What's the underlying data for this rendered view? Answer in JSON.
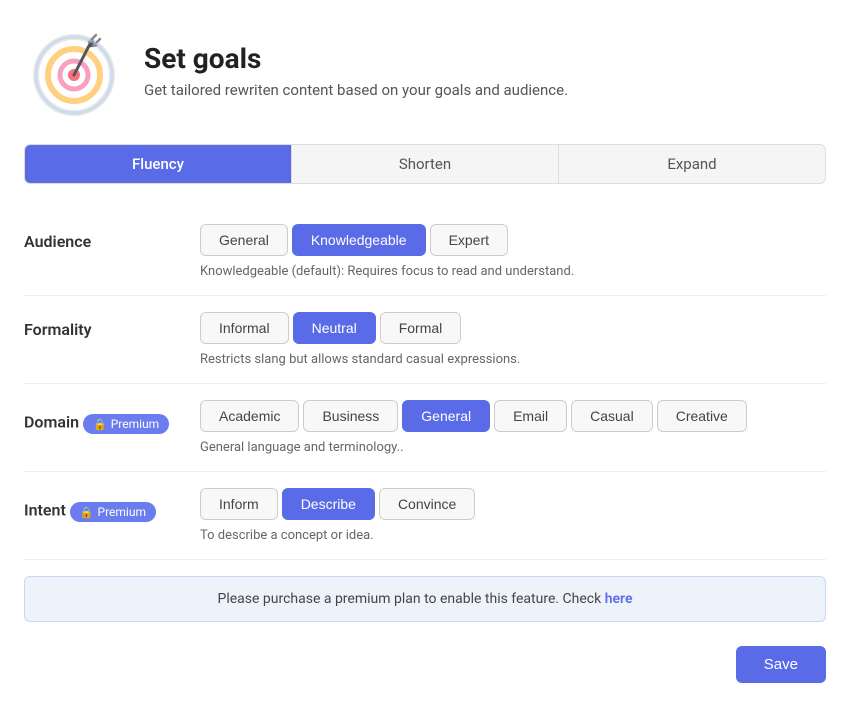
{
  "header": {
    "title": "Set goals",
    "subtitle": "Get tailored rewriten content based on your goals and audience."
  },
  "tabs": [
    {
      "label": "Fluency",
      "active": true
    },
    {
      "label": "Shorten",
      "active": false
    },
    {
      "label": "Expand",
      "active": false
    }
  ],
  "audience": {
    "label": "Audience",
    "options": [
      "General",
      "Knowledgeable",
      "Expert"
    ],
    "active": "Knowledgeable",
    "description": "Knowledgeable (default): Requires focus to read and understand."
  },
  "formality": {
    "label": "Formality",
    "options": [
      "Informal",
      "Neutral",
      "Formal"
    ],
    "active": "Neutral",
    "description": "Restricts slang but allows standard casual expressions."
  },
  "domain": {
    "label": "Domain",
    "premium_label": "Premium",
    "options": [
      "Academic",
      "Business",
      "General",
      "Email",
      "Casual",
      "Creative"
    ],
    "active": "General",
    "description": "General language and terminology.."
  },
  "intent": {
    "label": "Intent",
    "premium_label": "Premium",
    "options": [
      "Inform",
      "Describe",
      "Convince"
    ],
    "active": "Describe",
    "description": "To describe a concept or idea."
  },
  "premium_notice": {
    "text": "Please purchase a premium plan to enable this feature. Check",
    "link_text": "here"
  },
  "save_button": "Save"
}
